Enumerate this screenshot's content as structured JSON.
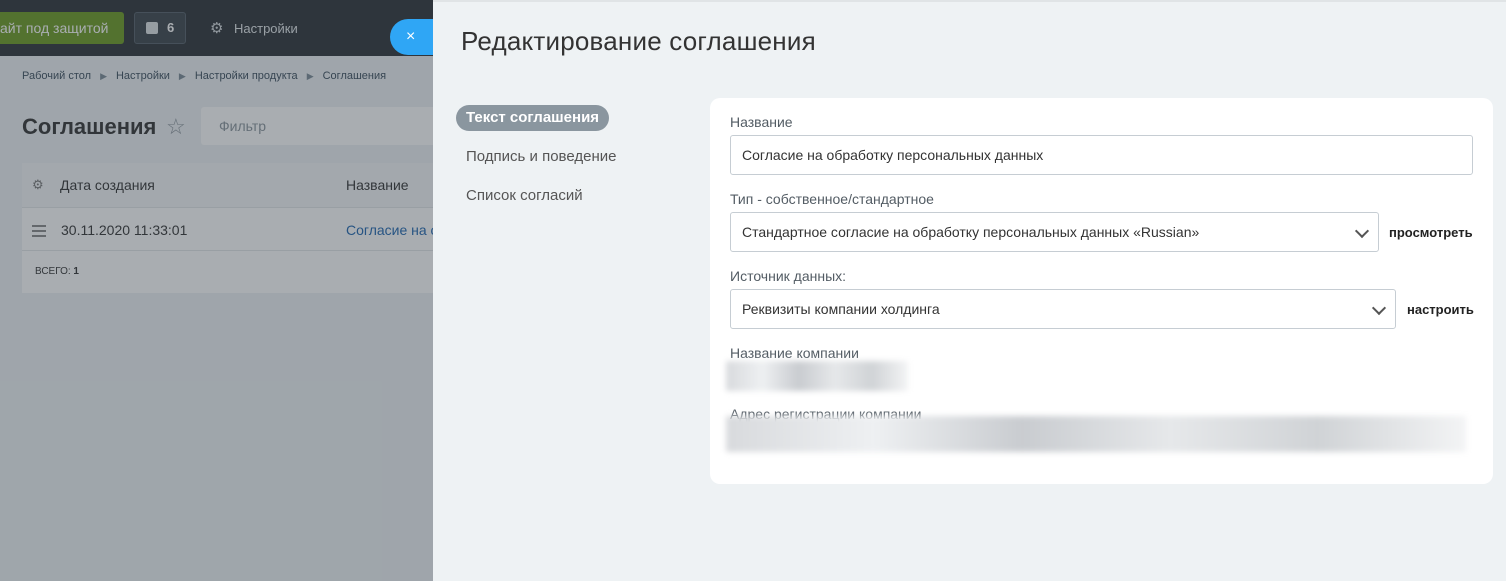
{
  "background": {
    "site_button": "айт под защитой",
    "notifications_count": "6",
    "settings_label": "Настройки",
    "breadcrumbs": [
      "Рабочий стол",
      "Настройки",
      "Настройки продукта",
      "Соглашения"
    ],
    "page_title": "Соглашения",
    "filter_placeholder": "Фильтр",
    "grid": {
      "columns": [
        "Дата создания",
        "Название"
      ],
      "rows": [
        {
          "date": "30.11.2020 11:33:01",
          "name": "Согласие на о"
        }
      ],
      "total_label": "всего:",
      "total_value": "1"
    },
    "close_symbol": "×"
  },
  "panel": {
    "title": "Редактирование соглашения",
    "tabs": [
      "Текст соглашения",
      "Подпись и поведение",
      "Список согласий"
    ],
    "form": {
      "name_label": "Название",
      "name_value": "Согласие на обработку персональных данных",
      "type_label": "Тип - собственное/стандартное",
      "type_value": "Стандартное согласие на обработку персональных данных «Russian»",
      "type_link": "просмотреть",
      "source_label": "Источник данных:",
      "source_value": "Реквизиты компании холдинга",
      "source_link": "настроить",
      "company_name_label": "Название компании",
      "company_address_label": "Адрес регистрации компании"
    }
  }
}
